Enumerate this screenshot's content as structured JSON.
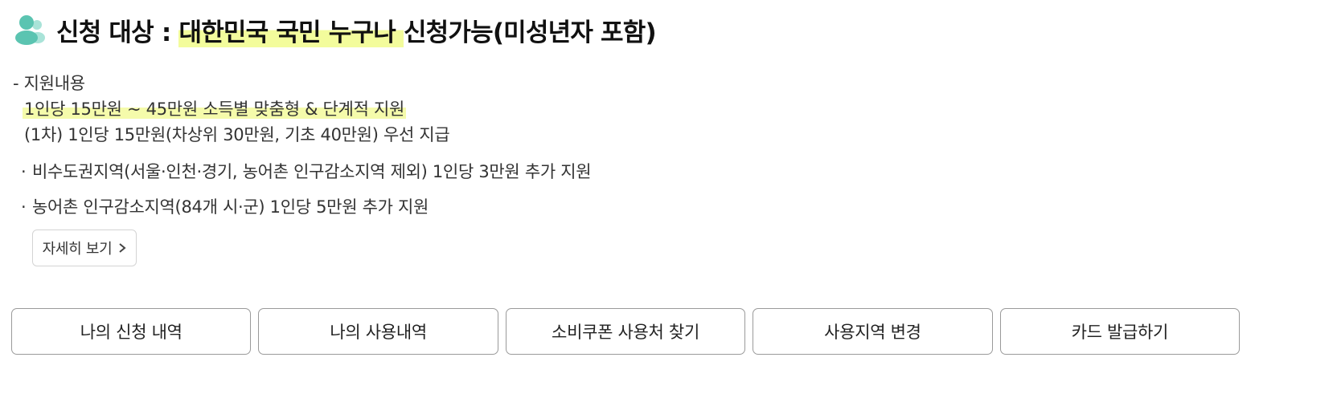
{
  "heading": {
    "icon": "people-icon",
    "prefix": "신청 대상 : ",
    "highlight": "대한민국 국민 누구나 ",
    "suffix": "신청가능(미성년자 포함)",
    "icon_color": "#5bc4b1",
    "highlight_color": "#f3fc9c"
  },
  "support": {
    "title": "- 지원내용",
    "highlight_line": "1인당 15만원 ~ 45만원 소득별 맞춤형 & 단계적 지원",
    "first_round": "(1차) 1인당 15만원(차상위 30만원, 기초 40만원) 우선 지급",
    "bullets": [
      {
        "marker": "·",
        "text": "비수도권지역(서울·인천·경기, 농어촌 인구감소지역 제외) 1인당 3만원 추가 지원"
      },
      {
        "marker": "·",
        "text": "농어촌 인구감소지역(84개 시·군) 1인당 5만원 추가 지원"
      }
    ],
    "detail_button": "자세히 보기",
    "detail_icon": "chevron-right-icon"
  },
  "actions": [
    {
      "label": "나의 신청 내역"
    },
    {
      "label": "나의 사용내역"
    },
    {
      "label": "소비쿠폰 사용처 찾기"
    },
    {
      "label": "사용지역 변경"
    },
    {
      "label": "카드 발급하기"
    }
  ]
}
